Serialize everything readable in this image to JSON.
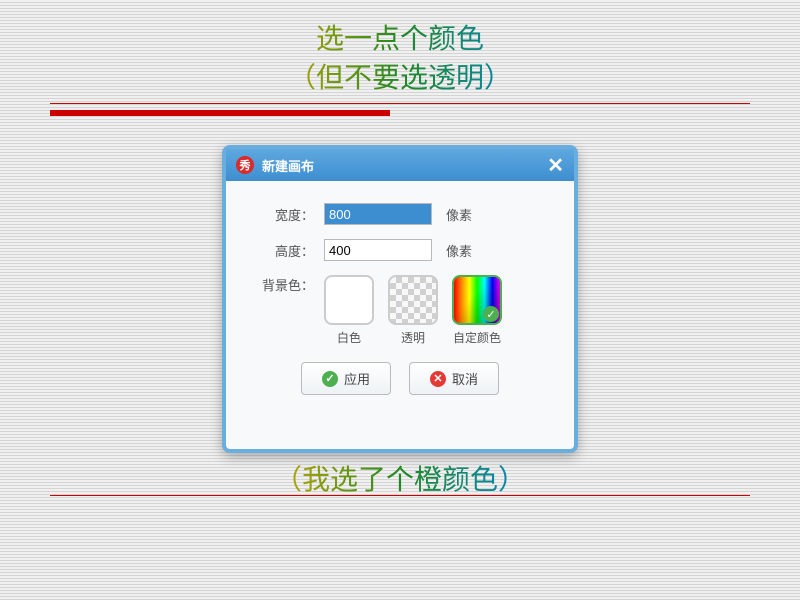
{
  "annotations": {
    "top_line1": "选一点个颜色",
    "top_line2": "（但不要选透明）",
    "bottom_line": "（我选了个橙颜色）"
  },
  "dialog": {
    "logo": "秀",
    "title": "新建画布",
    "width_label": "宽度：",
    "width_value": "800",
    "height_label": "高度：",
    "height_value": "400",
    "unit": "像素",
    "bg_label": "背景色：",
    "bg_white": "白色",
    "bg_transparent": "透明",
    "bg_custom": "自定颜色",
    "apply": "应用",
    "cancel": "取消"
  }
}
